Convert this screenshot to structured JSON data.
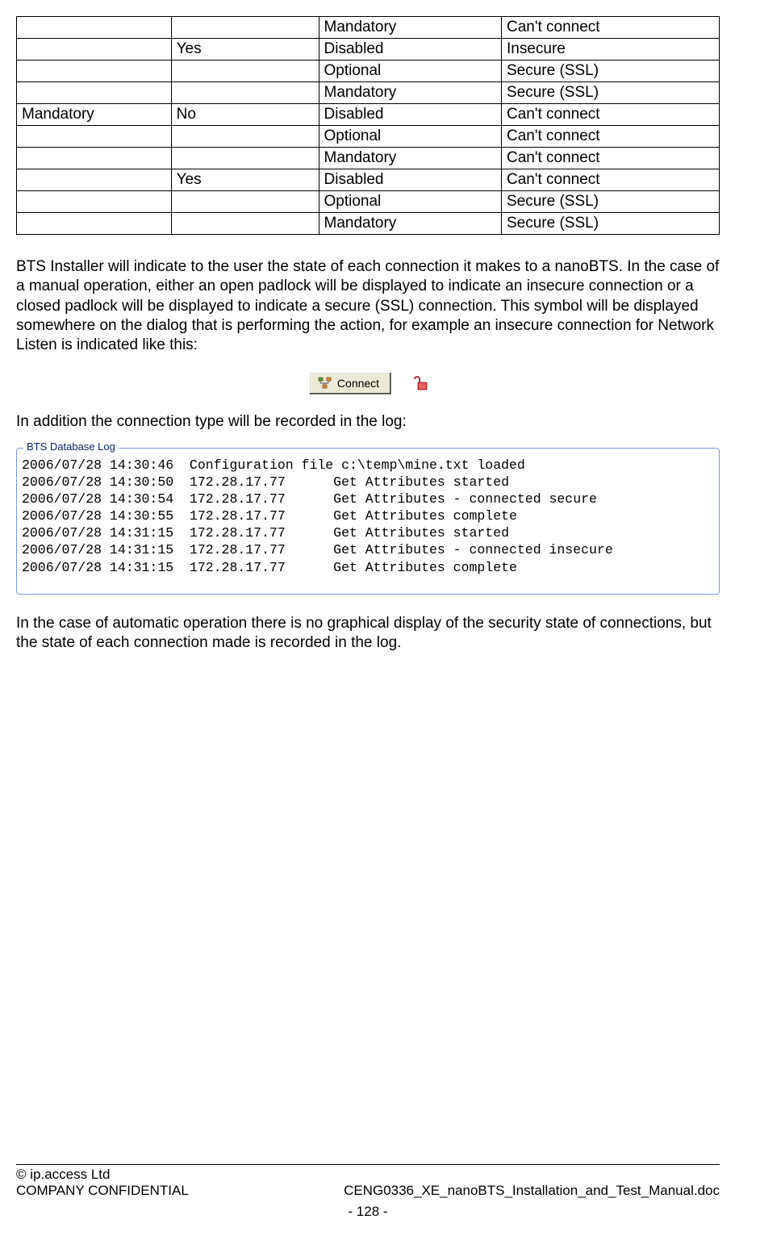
{
  "table": {
    "rows": [
      [
        "",
        "",
        "Mandatory",
        "Can't connect"
      ],
      [
        "",
        "Yes",
        "Disabled",
        "Insecure"
      ],
      [
        "",
        "",
        "Optional",
        "Secure (SSL)"
      ],
      [
        "",
        "",
        "Mandatory",
        "Secure (SSL)"
      ],
      [
        "Mandatory",
        "No",
        "Disabled",
        "Can't connect"
      ],
      [
        "",
        "",
        "Optional",
        "Can't connect"
      ],
      [
        "",
        "",
        "Mandatory",
        "Can't connect"
      ],
      [
        "",
        "Yes",
        "Disabled",
        "Can't connect"
      ],
      [
        "",
        "",
        "Optional",
        "Secure (SSL)"
      ],
      [
        "",
        "",
        "Mandatory",
        "Secure (SSL)"
      ]
    ]
  },
  "para1": "BTS Installer will indicate to the user the state of each connection it makes to a nanoBTS. In the case of a manual operation, either an open padlock will be displayed to indicate an insecure connection or a closed padlock will be displayed to indicate a secure (SSL) connection. This symbol will be displayed somewhere on the dialog that is performing the action, for example an insecure connection for Network Listen is indicated like this:",
  "connect_label": "Connect",
  "para2": "In addition the connection type will be recorded in the log:",
  "log": {
    "legend": "BTS Database Log",
    "lines": [
      "2006/07/28 14:30:46  Configuration file c:\\temp\\mine.txt loaded",
      "2006/07/28 14:30:50  172.28.17.77      Get Attributes started",
      "2006/07/28 14:30:54  172.28.17.77      Get Attributes - connected secure",
      "2006/07/28 14:30:55  172.28.17.77      Get Attributes complete",
      "2006/07/28 14:31:15  172.28.17.77      Get Attributes started",
      "2006/07/28 14:31:15  172.28.17.77      Get Attributes - connected insecure",
      "2006/07/28 14:31:15  172.28.17.77      Get Attributes complete"
    ]
  },
  "para3": "In the case of automatic operation there is no graphical display of the security state of connections, but the state of each connection made is recorded in the log.",
  "footer": {
    "copyright": "© ip.access Ltd",
    "confidential": "COMPANY CONFIDENTIAL",
    "docname": "CENG0336_XE_nanoBTS_Installation_and_Test_Manual.doc",
    "page": "- 128 -"
  }
}
